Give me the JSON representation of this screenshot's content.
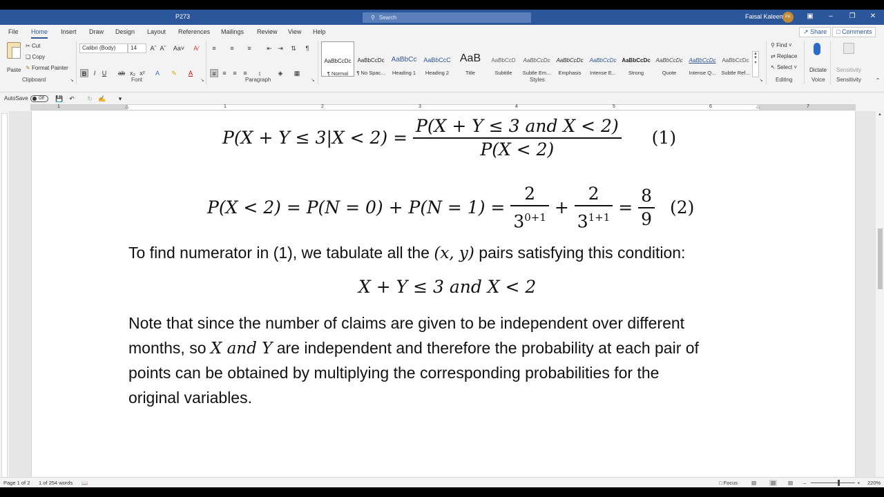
{
  "titlebar": {
    "doc_title": "P273",
    "search_placeholder": "Search",
    "user_name": "Faisal Kaleem",
    "user_initials": "FK"
  },
  "tabs": [
    "File",
    "Home",
    "Insert",
    "Draw",
    "Design",
    "Layout",
    "References",
    "Mailings",
    "Review",
    "View",
    "Help"
  ],
  "active_tab": "Home",
  "share_label": "Share",
  "comments_label": "Comments",
  "clipboard": {
    "paste": "Paste",
    "cut": "Cut",
    "copy": "Copy",
    "format_painter": "Format Painter",
    "group": "Clipboard"
  },
  "font": {
    "name": "Calibri (Body)",
    "size": "14",
    "group": "Font"
  },
  "paragraph_group": "Paragraph",
  "styles": {
    "group": "Styles",
    "items": [
      {
        "preview": "AaBbCcDc",
        "name": "¶ Normal"
      },
      {
        "preview": "AaBbCcDc",
        "name": "¶ No Spac..."
      },
      {
        "preview": "AaBbCc",
        "name": "Heading 1"
      },
      {
        "preview": "AaBbCcC",
        "name": "Heading 2"
      },
      {
        "preview": "AaB",
        "name": "Title"
      },
      {
        "preview": "AaBbCcD",
        "name": "Subtitle"
      },
      {
        "preview": "AaBbCcDc",
        "name": "Subtle Em..."
      },
      {
        "preview": "AaBbCcDc",
        "name": "Emphasis"
      },
      {
        "preview": "AaBbCcDc",
        "name": "Intense E..."
      },
      {
        "preview": "AaBbCcDc",
        "name": "Strong"
      },
      {
        "preview": "AaBbCcDc",
        "name": "Quote"
      },
      {
        "preview": "AaBbCcDc",
        "name": "Intense Q..."
      },
      {
        "preview": "AaBbCcDc",
        "name": "Subtle Ref..."
      }
    ]
  },
  "editing": {
    "find": "Find",
    "replace": "Replace",
    "select": "Select",
    "group": "Editing"
  },
  "voice": {
    "dictate": "Dictate",
    "group": "Voice"
  },
  "sensitivity": {
    "label": "Sensitivity",
    "group": "Sensitivity"
  },
  "qat": {
    "autosave": "AutoSave",
    "autosave_state": "Off"
  },
  "ruler_numbers": [
    "1",
    "1",
    "2",
    "3",
    "4",
    "5",
    "6",
    "7"
  ],
  "document": {
    "eq1": {
      "lhs": "P(X + Y ≤ 3|X < 2) =",
      "num": "P(X + Y ≤ 3 and X < 2)",
      "den": "P(X < 2)",
      "tag": "(1)"
    },
    "eq2": {
      "lhs": "P(X < 2) = P(N = 0) + P(N = 1) =",
      "f1_num": "2",
      "f1_den_base": "3",
      "f1_den_exp": "0+1",
      "plus": "+",
      "f2_num": "2",
      "f2_den_base": "3",
      "f2_den_exp": "1+1",
      "eq": "=",
      "f3_num": "8",
      "f3_den": "9",
      "tag": "(2)"
    },
    "para1_a": "To find numerator in (1), we tabulate all the",
    "para1_math": "(x, y)",
    "para1_b": "pairs satisfying this condition:",
    "condition": "X + Y ≤ 3 and X < 2",
    "para2_line1": "Note that since the number of claims are given to be independent over different",
    "para2_line2_a": "months, so",
    "para2_line2_math": "X and Y",
    "para2_line2_b": "are independent and therefore the probability at each pair of",
    "para2_line3": "points can be obtained by multiplying the corresponding probabilities for the",
    "para2_line4": "original variables."
  },
  "status": {
    "page": "Page 1 of 2",
    "words": "1 of 254 words",
    "focus": "Focus",
    "zoom": "220%"
  }
}
